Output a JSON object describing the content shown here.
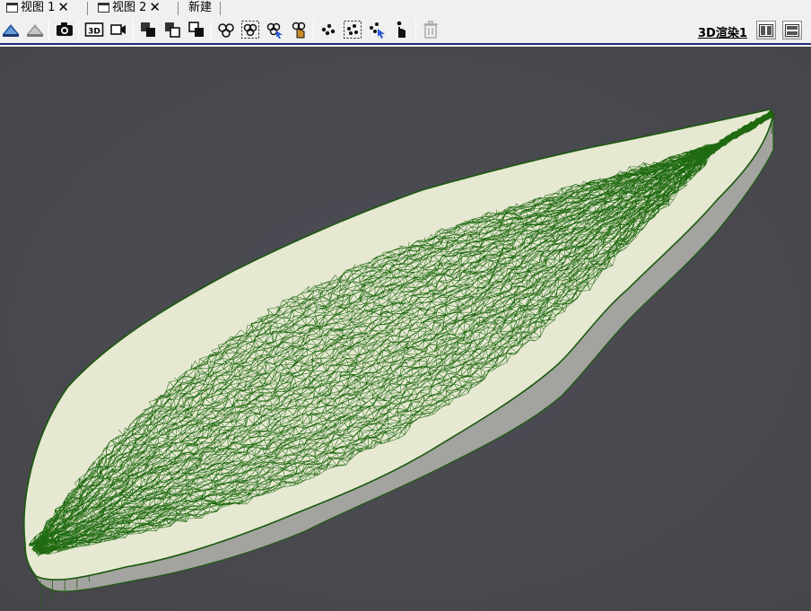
{
  "tabs": [
    {
      "label": "视图 1",
      "close": "✕"
    },
    {
      "label": "视图 2",
      "close": "✕"
    },
    {
      "label": "新建"
    }
  ],
  "toolbar": {
    "view_title": "3D渲染1",
    "buttons": [
      "reset-camera-icon",
      "reset-camera-closest-icon",
      "camera-icon",
      "3d-mode-icon",
      "video-camera-icon",
      "select-cells-on-icon",
      "select-points-on-icon",
      "select-cells-frustum-icon",
      "select-cells-polygon-icon",
      "select-block-icon",
      "interactive-select-cells-icon",
      "hover-cells-icon",
      "select-points-icon",
      "select-points-box-icon",
      "interactive-select-points-icon",
      "hover-points-icon",
      "clear-selection-icon"
    ]
  },
  "viewport": {
    "background": "#4a4a52",
    "surface_fill": "#e8e9d6",
    "wireframe_color": "#1e6a10",
    "side_color": "#a0a09e"
  }
}
